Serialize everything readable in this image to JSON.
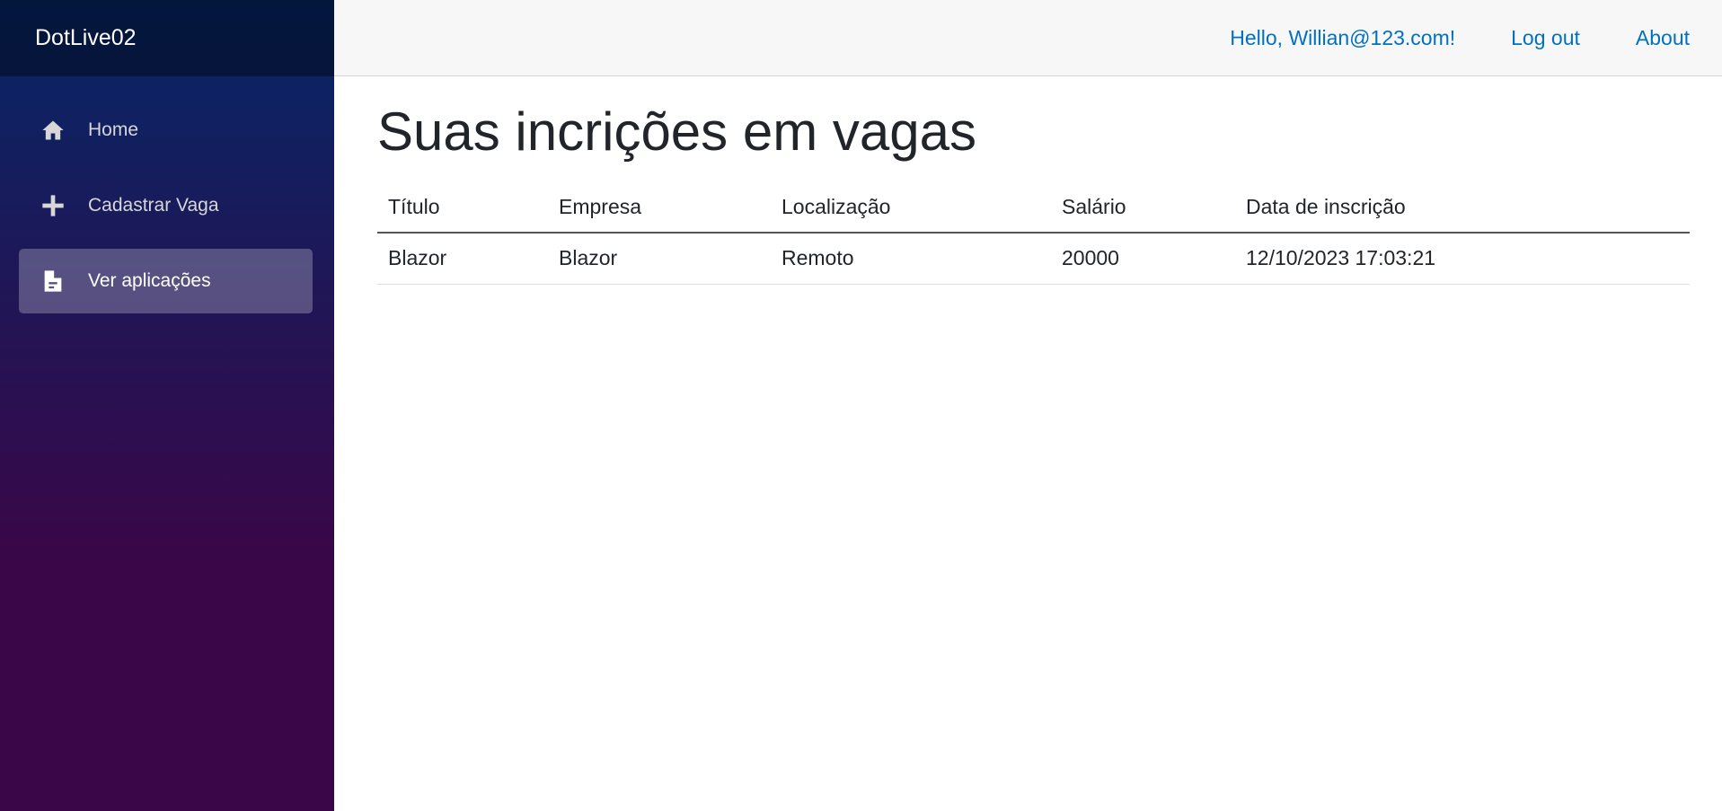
{
  "brand": "DotLive02",
  "nav": [
    {
      "label": "Home",
      "icon": "home-icon",
      "active": false
    },
    {
      "label": "Cadastrar Vaga",
      "icon": "plus-icon",
      "active": false
    },
    {
      "label": "Ver aplicações",
      "icon": "document-icon",
      "active": true
    }
  ],
  "top": {
    "greeting": "Hello, Willian@123.com!",
    "logout": "Log out",
    "about": "About"
  },
  "page": {
    "title": "Suas incrições em vagas"
  },
  "table": {
    "headers": [
      "Título",
      "Empresa",
      "Localização",
      "Salário",
      "Data de inscrição"
    ],
    "rows": [
      [
        "Blazor",
        "Blazor",
        "Remoto",
        "20000",
        "12/10/2023 17:03:21"
      ]
    ]
  },
  "colors": {
    "link": "#0071c1",
    "sidebar_top": "#052767",
    "sidebar_bottom": "#3a0647"
  }
}
